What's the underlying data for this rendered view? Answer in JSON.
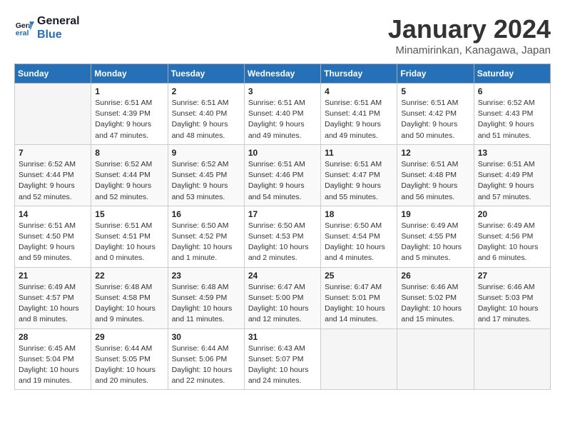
{
  "logo": {
    "line1": "General",
    "line2": "Blue"
  },
  "title": "January 2024",
  "subtitle": "Minamirinkan, Kanagawa, Japan",
  "weekdays": [
    "Sunday",
    "Monday",
    "Tuesday",
    "Wednesday",
    "Thursday",
    "Friday",
    "Saturday"
  ],
  "weeks": [
    [
      {
        "day": "",
        "info": ""
      },
      {
        "day": "1",
        "info": "Sunrise: 6:51 AM\nSunset: 4:39 PM\nDaylight: 9 hours\nand 47 minutes."
      },
      {
        "day": "2",
        "info": "Sunrise: 6:51 AM\nSunset: 4:40 PM\nDaylight: 9 hours\nand 48 minutes."
      },
      {
        "day": "3",
        "info": "Sunrise: 6:51 AM\nSunset: 4:40 PM\nDaylight: 9 hours\nand 49 minutes."
      },
      {
        "day": "4",
        "info": "Sunrise: 6:51 AM\nSunset: 4:41 PM\nDaylight: 9 hours\nand 49 minutes."
      },
      {
        "day": "5",
        "info": "Sunrise: 6:51 AM\nSunset: 4:42 PM\nDaylight: 9 hours\nand 50 minutes."
      },
      {
        "day": "6",
        "info": "Sunrise: 6:52 AM\nSunset: 4:43 PM\nDaylight: 9 hours\nand 51 minutes."
      }
    ],
    [
      {
        "day": "7",
        "info": "Sunrise: 6:52 AM\nSunset: 4:44 PM\nDaylight: 9 hours\nand 52 minutes."
      },
      {
        "day": "8",
        "info": "Sunrise: 6:52 AM\nSunset: 4:44 PM\nDaylight: 9 hours\nand 52 minutes."
      },
      {
        "day": "9",
        "info": "Sunrise: 6:52 AM\nSunset: 4:45 PM\nDaylight: 9 hours\nand 53 minutes."
      },
      {
        "day": "10",
        "info": "Sunrise: 6:51 AM\nSunset: 4:46 PM\nDaylight: 9 hours\nand 54 minutes."
      },
      {
        "day": "11",
        "info": "Sunrise: 6:51 AM\nSunset: 4:47 PM\nDaylight: 9 hours\nand 55 minutes."
      },
      {
        "day": "12",
        "info": "Sunrise: 6:51 AM\nSunset: 4:48 PM\nDaylight: 9 hours\nand 56 minutes."
      },
      {
        "day": "13",
        "info": "Sunrise: 6:51 AM\nSunset: 4:49 PM\nDaylight: 9 hours\nand 57 minutes."
      }
    ],
    [
      {
        "day": "14",
        "info": "Sunrise: 6:51 AM\nSunset: 4:50 PM\nDaylight: 9 hours\nand 59 minutes."
      },
      {
        "day": "15",
        "info": "Sunrise: 6:51 AM\nSunset: 4:51 PM\nDaylight: 10 hours\nand 0 minutes."
      },
      {
        "day": "16",
        "info": "Sunrise: 6:50 AM\nSunset: 4:52 PM\nDaylight: 10 hours\nand 1 minute."
      },
      {
        "day": "17",
        "info": "Sunrise: 6:50 AM\nSunset: 4:53 PM\nDaylight: 10 hours\nand 2 minutes."
      },
      {
        "day": "18",
        "info": "Sunrise: 6:50 AM\nSunset: 4:54 PM\nDaylight: 10 hours\nand 4 minutes."
      },
      {
        "day": "19",
        "info": "Sunrise: 6:49 AM\nSunset: 4:55 PM\nDaylight: 10 hours\nand 5 minutes."
      },
      {
        "day": "20",
        "info": "Sunrise: 6:49 AM\nSunset: 4:56 PM\nDaylight: 10 hours\nand 6 minutes."
      }
    ],
    [
      {
        "day": "21",
        "info": "Sunrise: 6:49 AM\nSunset: 4:57 PM\nDaylight: 10 hours\nand 8 minutes."
      },
      {
        "day": "22",
        "info": "Sunrise: 6:48 AM\nSunset: 4:58 PM\nDaylight: 10 hours\nand 9 minutes."
      },
      {
        "day": "23",
        "info": "Sunrise: 6:48 AM\nSunset: 4:59 PM\nDaylight: 10 hours\nand 11 minutes."
      },
      {
        "day": "24",
        "info": "Sunrise: 6:47 AM\nSunset: 5:00 PM\nDaylight: 10 hours\nand 12 minutes."
      },
      {
        "day": "25",
        "info": "Sunrise: 6:47 AM\nSunset: 5:01 PM\nDaylight: 10 hours\nand 14 minutes."
      },
      {
        "day": "26",
        "info": "Sunrise: 6:46 AM\nSunset: 5:02 PM\nDaylight: 10 hours\nand 15 minutes."
      },
      {
        "day": "27",
        "info": "Sunrise: 6:46 AM\nSunset: 5:03 PM\nDaylight: 10 hours\nand 17 minutes."
      }
    ],
    [
      {
        "day": "28",
        "info": "Sunrise: 6:45 AM\nSunset: 5:04 PM\nDaylight: 10 hours\nand 19 minutes."
      },
      {
        "day": "29",
        "info": "Sunrise: 6:44 AM\nSunset: 5:05 PM\nDaylight: 10 hours\nand 20 minutes."
      },
      {
        "day": "30",
        "info": "Sunrise: 6:44 AM\nSunset: 5:06 PM\nDaylight: 10 hours\nand 22 minutes."
      },
      {
        "day": "31",
        "info": "Sunrise: 6:43 AM\nSunset: 5:07 PM\nDaylight: 10 hours\nand 24 minutes."
      },
      {
        "day": "",
        "info": ""
      },
      {
        "day": "",
        "info": ""
      },
      {
        "day": "",
        "info": ""
      }
    ]
  ]
}
